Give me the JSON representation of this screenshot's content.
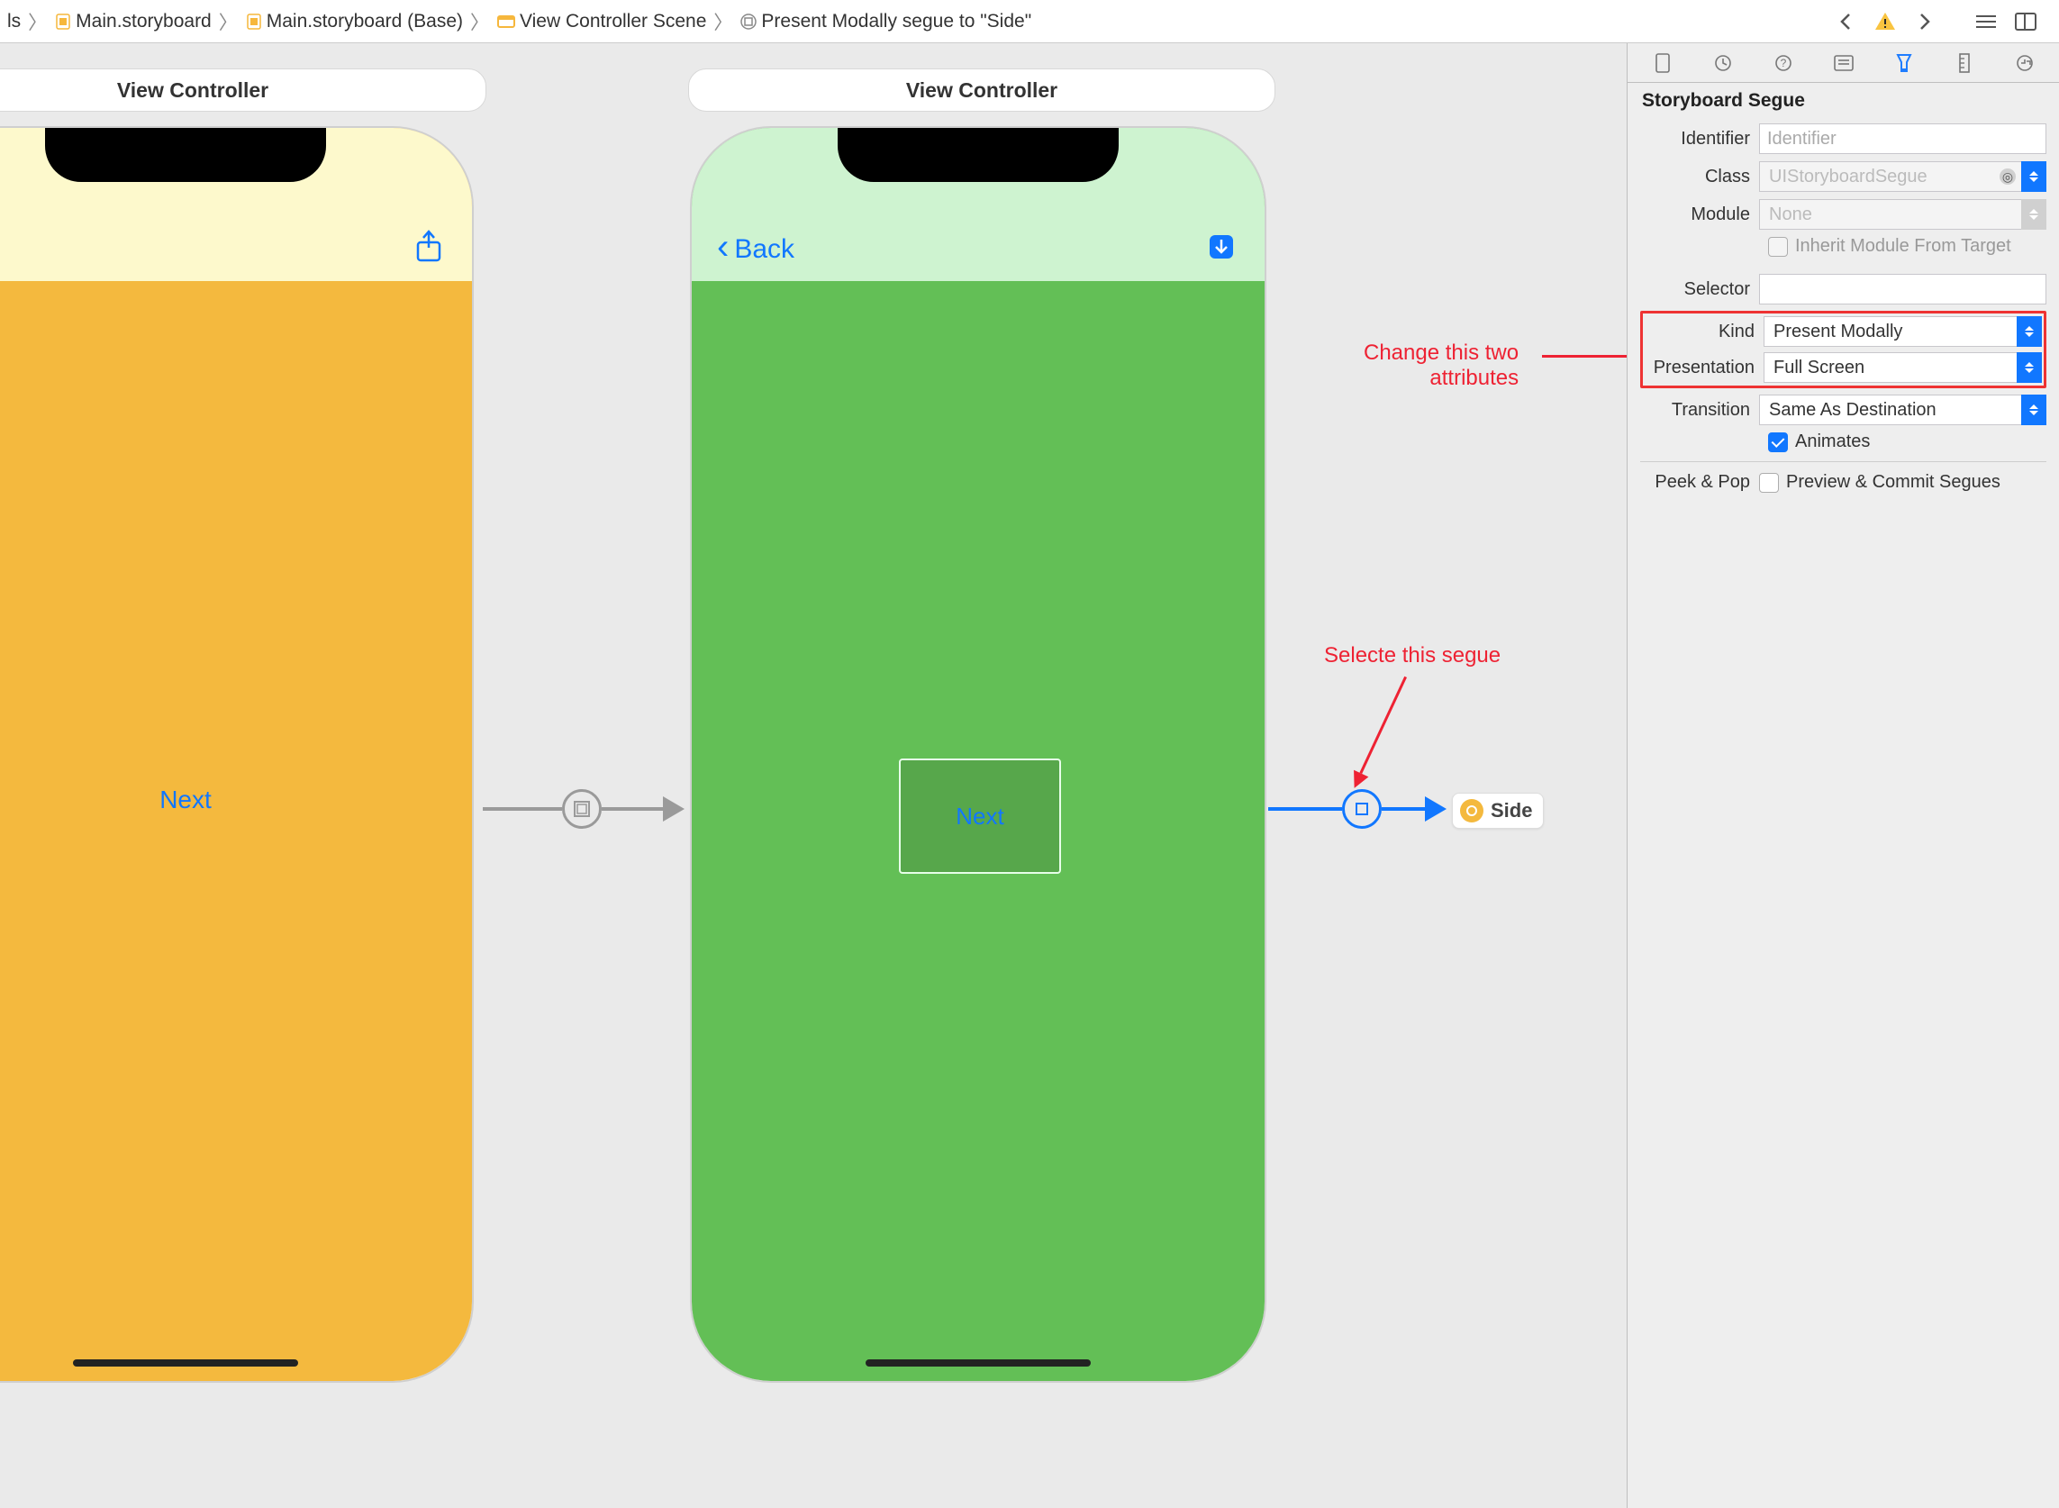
{
  "breadcrumb": {
    "item0_suffix": "ls",
    "item1": "Main.storyboard",
    "item2": "Main.storyboard (Base)",
    "item3": "View Controller Scene",
    "item4": "Present Modally segue to \"Side\""
  },
  "canvas": {
    "vc1_title": "View Controller",
    "vc2_title": "View Controller",
    "vc1_button": "Next",
    "vc2_back": "Back",
    "vc2_button": "Next",
    "side_chip": "Side"
  },
  "inspector": {
    "section_title": "Storyboard Segue",
    "identifier_label": "Identifier",
    "identifier_placeholder": "Identifier",
    "class_label": "Class",
    "class_value": "UIStoryboardSegue",
    "module_label": "Module",
    "module_value": "None",
    "inherit_label": "Inherit Module From Target",
    "selector_label": "Selector",
    "selector_value": "",
    "kind_label": "Kind",
    "kind_value": "Present Modally",
    "presentation_label": "Presentation",
    "presentation_value": "Full Screen",
    "transition_label": "Transition",
    "transition_value": "Same As Destination",
    "animates_label": "Animates",
    "peek_label": "Peek & Pop",
    "peek_option": "Preview & Commit Segues"
  },
  "annotations": {
    "anno1_line1": "Change this two",
    "anno1_line2": "attributes",
    "anno2": "Selecte this segue"
  }
}
